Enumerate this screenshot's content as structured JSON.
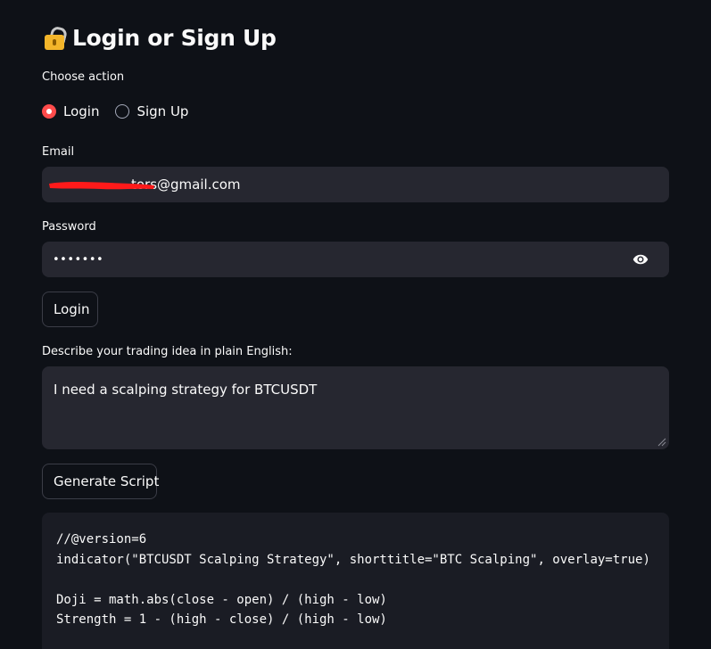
{
  "header": {
    "icon": "lock-icon",
    "title": "Login or Sign Up"
  },
  "auth_mode": {
    "label": "Choose action",
    "options": [
      {
        "label": "Login",
        "selected": true
      },
      {
        "label": "Sign Up",
        "selected": false
      }
    ]
  },
  "email": {
    "label": "Email",
    "value": "tors@gmail.com",
    "redacted": true
  },
  "password": {
    "label": "Password",
    "value": "•••••••",
    "toggle_icon": "eye-icon"
  },
  "login_button": {
    "label": "Login"
  },
  "idea": {
    "label": "Describe your trading idea in plain English:",
    "value": "I need a scalping strategy for BTCUSDT"
  },
  "generate_button": {
    "label": "Generate Script"
  },
  "code": {
    "lines": [
      "//@version=6",
      "indicator(\"BTCUSDT Scalping Strategy\", shorttitle=\"BTC Scalping\", overlay=true)",
      "",
      "Doji = math.abs(close - open) / (high - low)",
      "Strength = 1 - (high - close) / (high - low)"
    ]
  },
  "colors": {
    "background": "#0e1117",
    "input_bg": "#262730",
    "code_bg": "#1a1c24",
    "accent": "#ff4b4b",
    "redaction": "#ff1a1a"
  }
}
